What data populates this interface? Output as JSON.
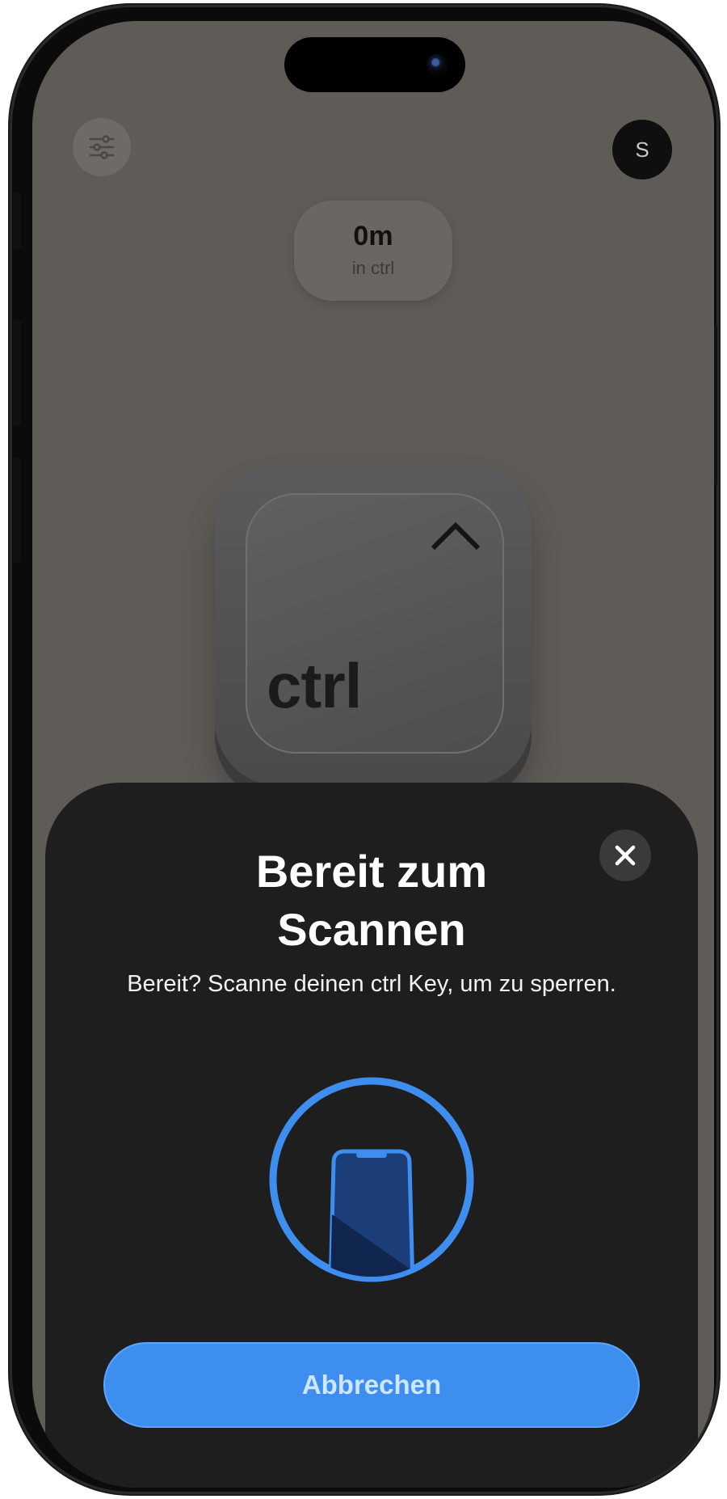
{
  "app": {
    "avatar_initial": "S",
    "time": {
      "value": "0m",
      "label": "in ctrl"
    },
    "key": {
      "label": "ctrl",
      "glyph": "^"
    }
  },
  "sheet": {
    "title": "Bereit zum Scannen",
    "message": "Bereit? Scanne deinen ctrl Key, um zu sperren.",
    "cancel_label": "Abbrechen",
    "close_icon": "close-icon",
    "illustration_icon": "phone-nfc-scan-icon"
  },
  "colors": {
    "accent": "#3e8ef0",
    "sheet_bg": "#1e1e1f",
    "screen_bg": "#5f5c58"
  }
}
